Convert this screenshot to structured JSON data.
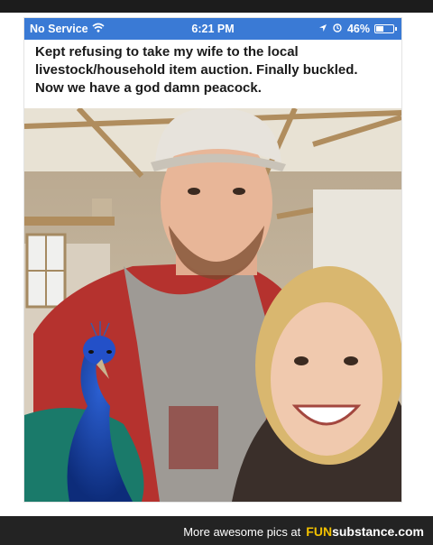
{
  "status_bar": {
    "carrier": "No Service",
    "time": "6:21 PM",
    "battery": "46%",
    "battery_level": 0.46,
    "icons": [
      "wifi-icon",
      "location-arrow-icon",
      "alarm-icon",
      "battery-icon"
    ]
  },
  "post": {
    "caption_lines": [
      "Kept refusing to take my wife to the local",
      "livestock/household item auction. Finally buckled.",
      "Now we have a god damn peacock."
    ]
  },
  "photo": {
    "subject": "selfie-with-peacock"
  },
  "footer": {
    "text": "More awesome pics at",
    "brand_part1": "FUN",
    "brand_part2": "substance.com"
  },
  "colors": {
    "status_bar": "#3a7ad5",
    "footer": "#232323",
    "brand_accent": "#f2c100"
  }
}
